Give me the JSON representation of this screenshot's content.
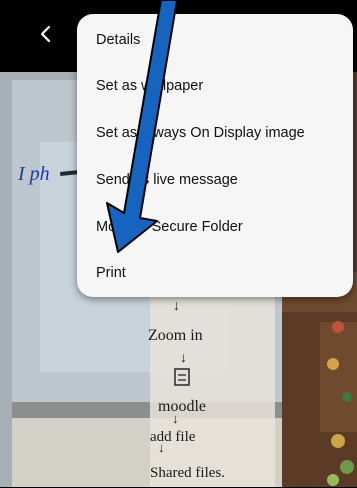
{
  "menu": {
    "items": [
      {
        "label": "Details"
      },
      {
        "label": "Set as wallpaper"
      },
      {
        "label": "Set as Always On Display image"
      },
      {
        "label": "Send as live message"
      },
      {
        "label": "Move to Secure Folder"
      },
      {
        "label": "Print"
      }
    ]
  },
  "photo": {
    "notes": [
      "I ph",
      "↓",
      "Zoom in",
      "↓",
      "moodle",
      "↓",
      "add file",
      "↓",
      "Shared files."
    ]
  },
  "icons": {
    "back": "chevron-left-icon",
    "annotation": "arrow-down-icon"
  },
  "colors": {
    "annotation_fill": "#1565c0",
    "menu_bg": "#f6f6f6",
    "topbar_bg": "#000000"
  }
}
